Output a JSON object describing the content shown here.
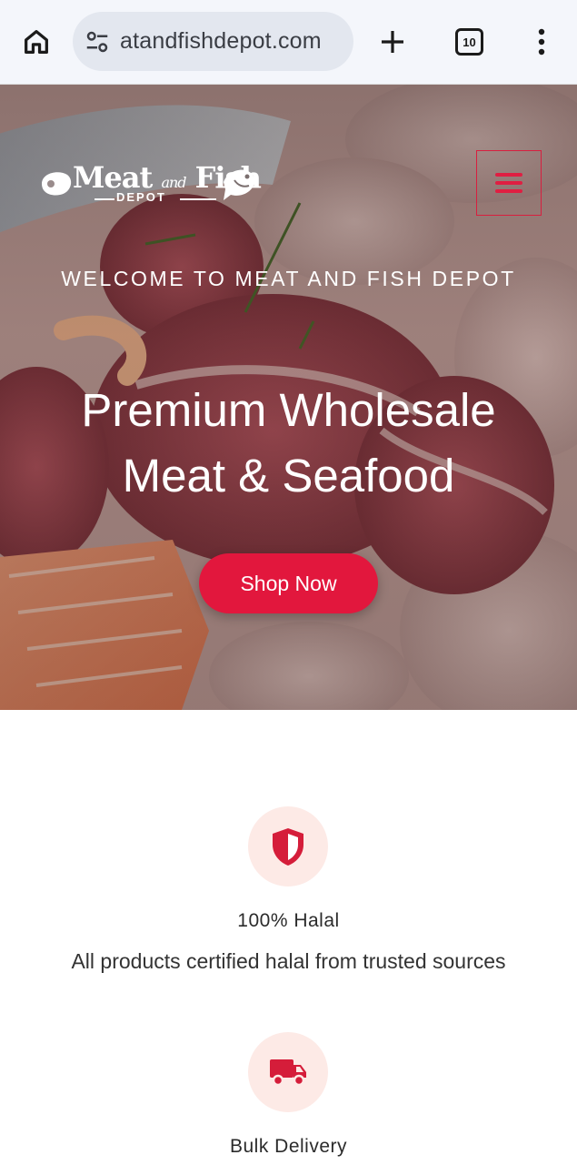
{
  "browser": {
    "url": "atandfishdepot.com",
    "tab_count": "10"
  },
  "hero": {
    "logo": {
      "meat": "Meat",
      "and": "and",
      "fish": "Fish",
      "depot": "DEPOT"
    },
    "welcome": "WELCOME TO MEAT AND FISH DEPOT",
    "headline_line1": "Premium Wholesale",
    "headline_line2": "Meat & Seafood",
    "cta_label": "Shop Now"
  },
  "features": [
    {
      "icon": "shield-icon",
      "title": "100% Halal",
      "description": "All products certified halal from trusted sources"
    },
    {
      "icon": "truck-icon",
      "title": "Bulk Delivery",
      "description": ""
    }
  ],
  "colors": {
    "accent": "#e2173d",
    "icon_circle": "#fdeae6",
    "chrome_bg": "#f4f6fb"
  }
}
